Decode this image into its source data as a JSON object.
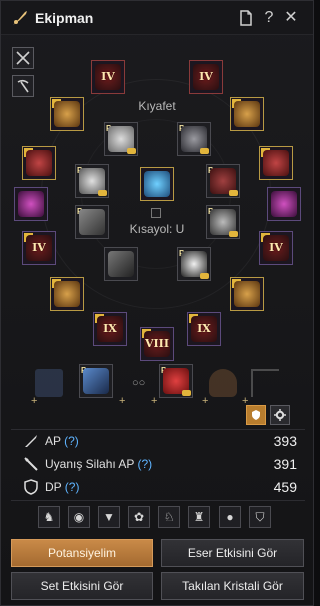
{
  "window": {
    "title": "Ekipman"
  },
  "titlebar": {
    "icons": [
      "quill-icon",
      "document-icon",
      "help-icon",
      "close-icon"
    ],
    "help_glyph": "?",
    "close_glyph": "✕"
  },
  "equipment": {
    "outfit_label": "Kıyafet",
    "shortcut_label": "Kısayol: U",
    "slots": [
      {
        "id": "top-left",
        "level": "IV"
      },
      {
        "id": "top-right",
        "level": "IV"
      },
      {
        "id": "mid-left-1",
        "level": "IV"
      },
      {
        "id": "mid-right-1",
        "level": "IV"
      },
      {
        "id": "bottom-1",
        "level": "IX"
      },
      {
        "id": "bottom-2",
        "level": "VIII"
      },
      {
        "id": "bottom-3",
        "level": "IX"
      }
    ]
  },
  "stats": [
    {
      "label": "AP",
      "help": "(?)",
      "value": "393",
      "icon": "sword-icon"
    },
    {
      "label": "Uyanış Silahı AP",
      "help": "(?)",
      "value": "391",
      "icon": "awakening-sword-icon"
    },
    {
      "label": "DP",
      "help": "(?)",
      "value": "459",
      "icon": "shield-icon"
    }
  ],
  "presets": [
    "horse-icon",
    "mask-icon",
    "cat-face-icon",
    "paw-icon",
    "camel-icon",
    "dragon-icon",
    "person-icon",
    "shield-small-icon"
  ],
  "buttons": {
    "potential": "Potansiyelim",
    "artifact": "Eser Etkisini Gör",
    "set": "Set Etkisini Gör",
    "crystal": "Takılan Kristali Gör"
  },
  "colors": {
    "accent": "#b87d2e",
    "purple_border": "#5c4a7c",
    "gold": "#e2b53c",
    "help_link": "#5fb4ff"
  }
}
